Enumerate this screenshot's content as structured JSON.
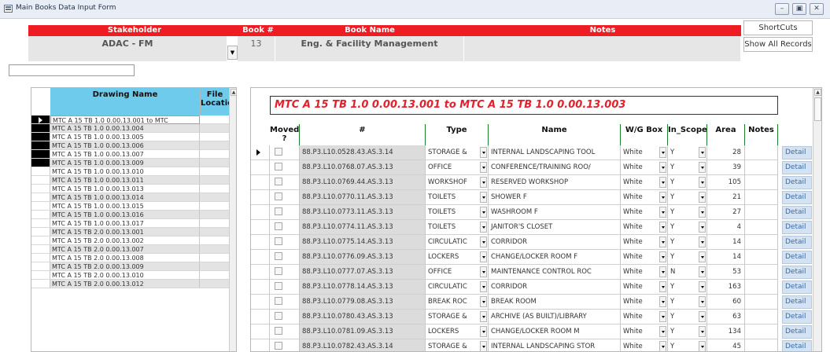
{
  "window": {
    "title": "Main Books Data Input Form",
    "controls": [
      "minimize",
      "restore",
      "close"
    ]
  },
  "header": {
    "stakeholder_label": "Stakeholder",
    "stakeholder_value": "ADAC - FM",
    "book_num_label": "Book #",
    "book_num_value": "13",
    "book_name_label": "Book Name",
    "book_name_value": "Eng. & Facility Management",
    "notes_label": "Notes",
    "notes_value": "",
    "accent_color": "#ee1c23"
  },
  "side_buttons": {
    "shortcuts": "ShortCuts",
    "show_all": "Show All Records"
  },
  "search": {
    "value": ""
  },
  "left_list": {
    "col_drawing": "Drawing Name",
    "col_file": "File Locatio",
    "header_color": "#6fcbeb",
    "rows": [
      "MTC A 15 TB    1.0 0.00.13.001 to MTC",
      "MTC A 15 TB    1.0 0.00.13.004",
      "MTC A 15 TB    1.0 0.00.13.005",
      "MTC A 15 TB    1.0 0.00.13.006",
      "MTC A 15 TB    1.0 0.00.13.007",
      "MTC A 15 TB    1.0 0.00.13.009",
      "MTC A 15 TB    1.0 0.00.13.010",
      "MTC A 15 TB    1.0 0.00.13.011",
      "MTC A 15 TB    1.0 0.00.13.013",
      "MTC A 15 TB    1.0 0.00.13.014",
      "MTC A 15 TB    1.0 0.00.13.015",
      "MTC A 15 TB    1.0 0.00.13.016",
      "MTC A 15 TB    1.0 0.00.13.017",
      "MTC A 15 TB    2.0 0.00.13.001",
      "MTC A 15 TB    2.0 0.00.13.002",
      "MTC A 15 TB    2.0 0.00.13.007",
      "MTC A 15 TB    2.0 0.00.13.008",
      "MTC A 15 TB    2.0 0.00.13.009",
      "MTC A 15 TB    2.0 0.00.13.010",
      "MTC A 15 TB    2.0 0.00.13.012"
    ]
  },
  "record": {
    "title": "MTC A 15 TB    1.0 0.00.13.001 to MTC A 15 TB 1.0 0.00.13.003"
  },
  "grid": {
    "header_color": "#2fb142",
    "columns": {
      "moved": "Moved ?",
      "num": "#",
      "type": "Type",
      "name": "Name",
      "wg": "W/G Box",
      "scope": "In_Scope",
      "area": "Area",
      "notes": "Notes"
    },
    "detail_label": "Detail",
    "rows": [
      {
        "num": "88.P3.L10.0528.43.AS.3.14",
        "type": "STORAGE &",
        "name": "INTERNAL LANDSCAPING TOOL",
        "wg": "White",
        "scope": "Y",
        "area": "28"
      },
      {
        "num": "88.P3.L10.0768.07.AS.3.13",
        "type": "OFFICE",
        "name": "CONFERENCE/TRAINING ROO/",
        "wg": "White",
        "scope": "Y",
        "area": "39"
      },
      {
        "num": "88.P3.L10.0769.44.AS.3.13",
        "type": "WORKSHOF",
        "name": "RESERVED WORKSHOP",
        "wg": "White",
        "scope": "Y",
        "area": "105"
      },
      {
        "num": "88.P3.L10.0770.11.AS.3.13",
        "type": "TOILETS",
        "name": "SHOWER F",
        "wg": "White",
        "scope": "Y",
        "area": "21"
      },
      {
        "num": "88.P3.L10.0773.11.AS.3.13",
        "type": "TOILETS",
        "name": "WASHROOM F",
        "wg": "White",
        "scope": "Y",
        "area": "27"
      },
      {
        "num": "88.P3.L10.0774.11.AS.3.13",
        "type": "TOILETS",
        "name": "JANITOR'S CLOSET",
        "wg": "White",
        "scope": "Y",
        "area": "4"
      },
      {
        "num": "88.P3.L10.0775.14.AS.3.13",
        "type": "CIRCULATIC",
        "name": "CORRIDOR",
        "wg": "White",
        "scope": "Y",
        "area": "14"
      },
      {
        "num": "88.P3.L10.0776.09.AS.3.13",
        "type": "LOCKERS",
        "name": "CHANGE/LOCKER ROOM F",
        "wg": "White",
        "scope": "Y",
        "area": "14"
      },
      {
        "num": "88.P3.L10.0777.07.AS.3.13",
        "type": "OFFICE",
        "name": "MAINTENANCE CONTROL ROC",
        "wg": "White",
        "scope": "N",
        "area": "53"
      },
      {
        "num": "88.P3.L10.0778.14.AS.3.13",
        "type": "CIRCULATIC",
        "name": "CORRIDOR",
        "wg": "White",
        "scope": "Y",
        "area": "163"
      },
      {
        "num": "88.P3.L10.0779.08.AS.3.13",
        "type": "BREAK ROC",
        "name": "BREAK ROOM",
        "wg": "White",
        "scope": "Y",
        "area": "60"
      },
      {
        "num": "88.P3.L10.0780.43.AS.3.13",
        "type": "STORAGE &",
        "name": "ARCHIVE (AS BUILT)/LIBRARY",
        "wg": "White",
        "scope": "Y",
        "area": "63"
      },
      {
        "num": "88.P3.L10.0781.09.AS.3.13",
        "type": "LOCKERS",
        "name": "CHANGE/LOCKER ROOM M",
        "wg": "White",
        "scope": "Y",
        "area": "134"
      },
      {
        "num": "88.P3.L10.0782.43.AS.3.14",
        "type": "STORAGE &",
        "name": "INTERNAL LANDSCAPING STOR",
        "wg": "White",
        "scope": "Y",
        "area": "45"
      }
    ]
  }
}
